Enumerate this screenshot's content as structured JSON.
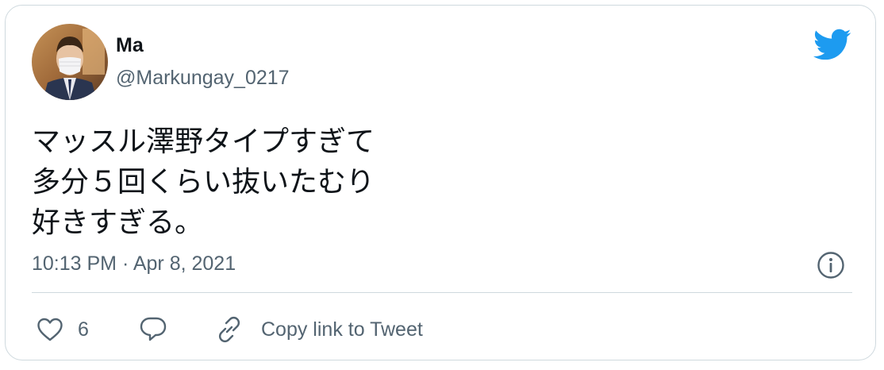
{
  "tweet": {
    "author": {
      "name": "Ma",
      "handle": "@Markungay_0217"
    },
    "text_lines": [
      "マッスル澤野タイプすぎて",
      "多分５回くらい抜いたむり",
      "好きすぎる。"
    ],
    "timestamp": "10:13 PM · Apr 8, 2021"
  },
  "actions": {
    "like_count": "6",
    "copy_link_label": "Copy link to Tweet"
  },
  "icons": {
    "brand": "twitter-bird-icon",
    "info": "info-icon",
    "like": "heart-icon",
    "reply": "reply-icon",
    "copy": "link-icon"
  },
  "colors": {
    "brand": "#1d9bf0",
    "text_primary": "#0f1419",
    "text_secondary": "#536471",
    "border": "#cfd9de"
  }
}
